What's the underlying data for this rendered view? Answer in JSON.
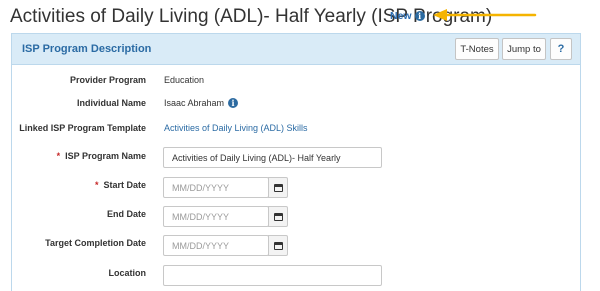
{
  "page": {
    "title": "Activities of Daily Living (ADL)- Half Yearly (ISP Program)",
    "new_label": "New",
    "info_glyph": "i",
    "accent_color": "#2b6ba4",
    "arrow_color": "#f5b400"
  },
  "panel": {
    "title": "ISP Program Description",
    "buttons": {
      "tnotes": "T-Notes",
      "jump": "Jump to",
      "help": "?"
    }
  },
  "form": {
    "required_marker": "*",
    "provider_program": {
      "label": "Provider Program",
      "value": "Education"
    },
    "individual_name": {
      "label": "Individual Name",
      "value": "Isaac Abraham"
    },
    "linked_template": {
      "label": "Linked ISP Program Template",
      "value": "Activities of Daily Living (ADL) Skills"
    },
    "isp_program_name": {
      "label": "ISP Program Name",
      "value": "Activities of Daily Living (ADL)- Half Yearly"
    },
    "start_date": {
      "label": "Start Date",
      "placeholder": "MM/DD/YYYY"
    },
    "end_date": {
      "label": "End Date",
      "placeholder": "MM/DD/YYYY"
    },
    "target_completion_date": {
      "label": "Target Completion Date",
      "placeholder": "MM/DD/YYYY"
    },
    "location": {
      "label": "Location",
      "value": ""
    }
  }
}
